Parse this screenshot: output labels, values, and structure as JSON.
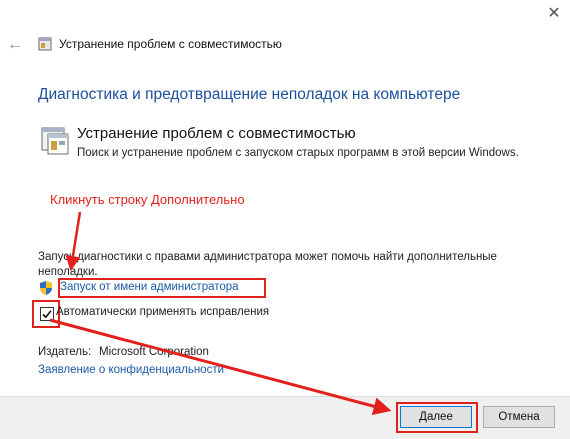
{
  "window": {
    "title": "Устранение проблем с совместимостью",
    "icons": {
      "back": "back-arrow-icon",
      "close": "close-icon",
      "app": "troubleshooter-icon"
    }
  },
  "main": {
    "heading": "Диагностика и предотвращение неполадок на компьютере",
    "tool": {
      "name": "Устранение проблем с совместимостью",
      "description": "Поиск и устранение проблем с запуском старых программ в этой версии Windows."
    },
    "info": "Запуск диагностики с правами администратора может помочь найти дополнительные неполадки.",
    "admin_link": "Запуск от имени администратора",
    "auto_fix": {
      "label": "Автоматически применять исправления",
      "checked": true
    },
    "publisher": {
      "label": "Издатель:",
      "value": "Microsoft Corporation"
    },
    "privacy_link": "Заявление о конфиденциальности"
  },
  "footer": {
    "next_label": "Далее",
    "cancel_label": "Отмена"
  },
  "annotation": {
    "note": "Кликнуть строку Дополнительно",
    "color": "#e3211c"
  },
  "colors": {
    "heading": "#1c4f9c",
    "link": "#1c5aa9",
    "footer_bg": "#f0f0f0",
    "accent": "#0078d7"
  }
}
